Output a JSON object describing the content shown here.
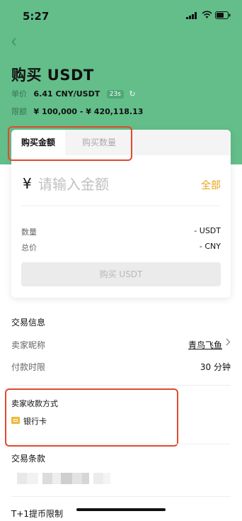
{
  "status_bar": {
    "time": "5:27"
  },
  "header": {
    "back_icon": "chevron-left-icon",
    "title": "购买 USDT",
    "unit_price_label": "单价",
    "unit_price_value": "6.41 CNY/USDT",
    "timer": "23s",
    "limit_label": "限额",
    "limit_value": "¥ 100,000 - ¥ 420,118.13",
    "accent_color": "#63be8a"
  },
  "card": {
    "tabs": [
      {
        "label": "购买金额",
        "active": true
      },
      {
        "label": "购买数量",
        "active": false
      }
    ],
    "currency_symbol": "¥",
    "amount_placeholder": "请输入金额",
    "all_label": "全部",
    "quantity_label": "数量",
    "quantity_value": "- USDT",
    "total_label": "总价",
    "total_value": "- CNY",
    "buy_button": "购买 USDT"
  },
  "trade_info": {
    "title": "交易信息",
    "seller_label": "卖家昵称",
    "seller_value": "青鸟飞鱼",
    "payment_time_label": "付款时限",
    "payment_time_value": "30 分钟"
  },
  "payment_methods": {
    "title": "卖家收款方式",
    "method": "银行卡",
    "method_icon": "bank-card-icon",
    "method_color": "#f0b93a"
  },
  "terms": {
    "title": "交易条款"
  },
  "withdraw_limit": {
    "title": "T+1提币限制"
  },
  "highlight_color": "#e04a2e"
}
